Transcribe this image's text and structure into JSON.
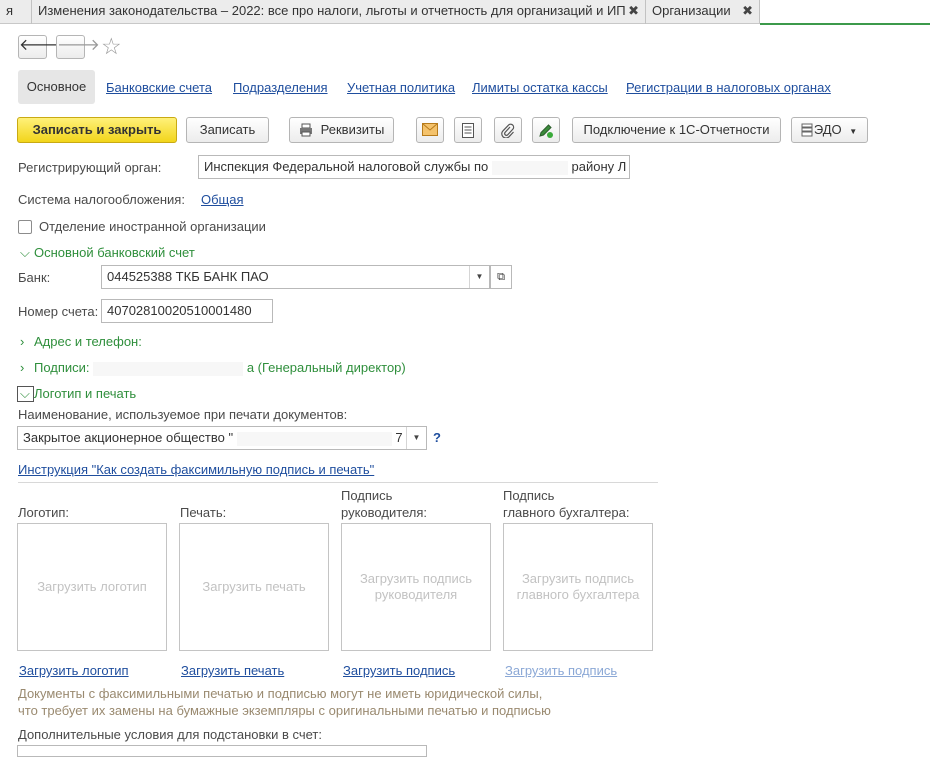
{
  "tabs": [
    {
      "label": "я"
    },
    {
      "label": "Изменения законодательства – 2022: все про налоги, льготы и отчетность для организаций и ИП"
    },
    {
      "label": "Организации"
    }
  ],
  "close_glyph": "✖",
  "nav": {
    "back": "🡐",
    "forward": "🡒",
    "star": "☆"
  },
  "form_tabs": [
    {
      "label": "Основное"
    },
    {
      "label": "Банковские счета"
    },
    {
      "label": "Подразделения"
    },
    {
      "label": "Учетная политика"
    },
    {
      "label": "Лимиты остатка кассы"
    },
    {
      "label": "Регистрации в налоговых органах"
    }
  ],
  "toolbar": {
    "save_close": "Записать и закрыть",
    "save": "Записать",
    "requisites": "Реквизиты",
    "connect": "Подключение к 1С-Отчетности",
    "edo": "ЭДО"
  },
  "fields": {
    "reg_label": "Регистрирующий орган:",
    "reg_value": "Инспекция Федеральной налоговой службы по",
    "reg_value_tail": "району Л",
    "tax_label": "Система налогообложения:",
    "tax_value": "Общая",
    "foreign_label": "Отделение иностранной организации",
    "bank_section": "Основной банковский счет",
    "bank_label": "Банк:",
    "bank_value": "044525388 ТКБ БАНК ПАО",
    "account_label": "Номер счета:",
    "account_value": "40702810020510001480",
    "address_section": "Адрес и телефон:",
    "signatures_section": "Подписи:",
    "signatures_tail": "а (Генеральный директор)",
    "logo_section": "Логотип и печать",
    "print_name_label": "Наименование, используемое при печати документов:",
    "print_name_value": "Закрытое акционерное общество \"",
    "print_name_tail": "7",
    "help": "?",
    "instruction_link": "Инструкция \"Как создать факсимильную подпись и печать\""
  },
  "images": [
    {
      "label": "Логотип:",
      "placeholder": "Загрузить логотип",
      "link": "Загрузить логотип"
    },
    {
      "label": "Печать:",
      "placeholder": "Загрузить печать",
      "link": "Загрузить печать"
    },
    {
      "label_line1": "Подпись",
      "label_line2": "руководителя:",
      "placeholder": "Загрузить подпись руководителя",
      "link": "Загрузить подпись"
    },
    {
      "label_line1": "Подпись",
      "label_line2": "главного бухгалтера:",
      "placeholder": "Загрузить подпись главного бухгалтера",
      "link": "Загрузить подпись"
    }
  ],
  "notes": {
    "line1": "Документы с факсимильными печатью и подписью могут не иметь юридической силы,",
    "line2": "что требует их замены на бумажные экземпляры с оригинальными печатью и подписью"
  },
  "extra_label": "Дополнительные условия для подстановки в счет:",
  "colors": {
    "accent_green": "#2f8f3c",
    "primary_button": "#f2d51b",
    "link": "#1f4e9e"
  }
}
